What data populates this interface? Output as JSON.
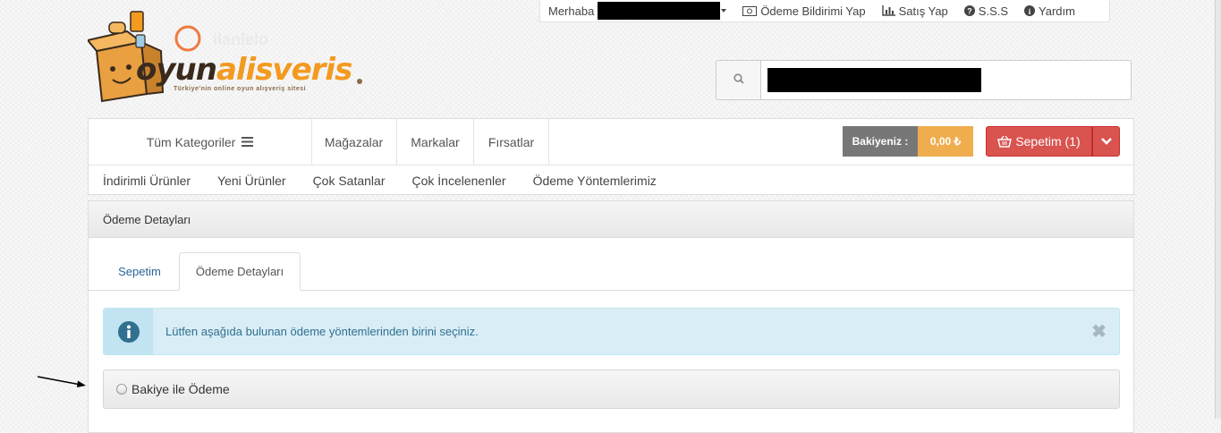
{
  "topbar": {
    "greeting": "Merhaba",
    "payment_notice": "Ödeme Bildirimi Yap",
    "sell": "Satış Yap",
    "faq": "S.S.S",
    "help": "Yardım"
  },
  "logo": {
    "brand_dark": "oyun",
    "brand_orange": "alisveris",
    "tagline": "Türkiye'nin online oyun alışveriş sitesi"
  },
  "search": {
    "placeholder": ""
  },
  "nav": {
    "all_categories": "Tüm Kategoriler",
    "stores": "Mağazalar",
    "brands": "Markalar",
    "deals": "Fırsatlar",
    "balance_label": "Bakiyeniz :",
    "balance_value": "0,00 ₺",
    "cart": "Sepetim (1)",
    "sub_links": [
      "İndirimli Ürünler",
      "Yeni Ürünler",
      "Çok Satanlar",
      "Çok İncelenenler",
      "Ödeme Yöntemlerimiz"
    ]
  },
  "panel": {
    "title": "Ödeme Detayları",
    "tabs": [
      "Sepetim",
      "Ödeme Detayları"
    ],
    "alert": "Lütfen aşağıda bulunan ödeme yöntemlerinden birini seçiniz.",
    "alert_close": "✖",
    "option": "Bakiye ile Ödeme"
  },
  "colors": {
    "danger": "#d9534f",
    "warning": "#f0ad4e",
    "info_bg": "#d9edf7",
    "link": "#2a6496"
  },
  "icons": [
    "money-icon",
    "bar-chart-icon",
    "question-circle-icon",
    "info-circle-icon",
    "search-icon",
    "bars-icon",
    "basket-icon",
    "chevron-down-icon",
    "info-icon",
    "close-icon"
  ]
}
